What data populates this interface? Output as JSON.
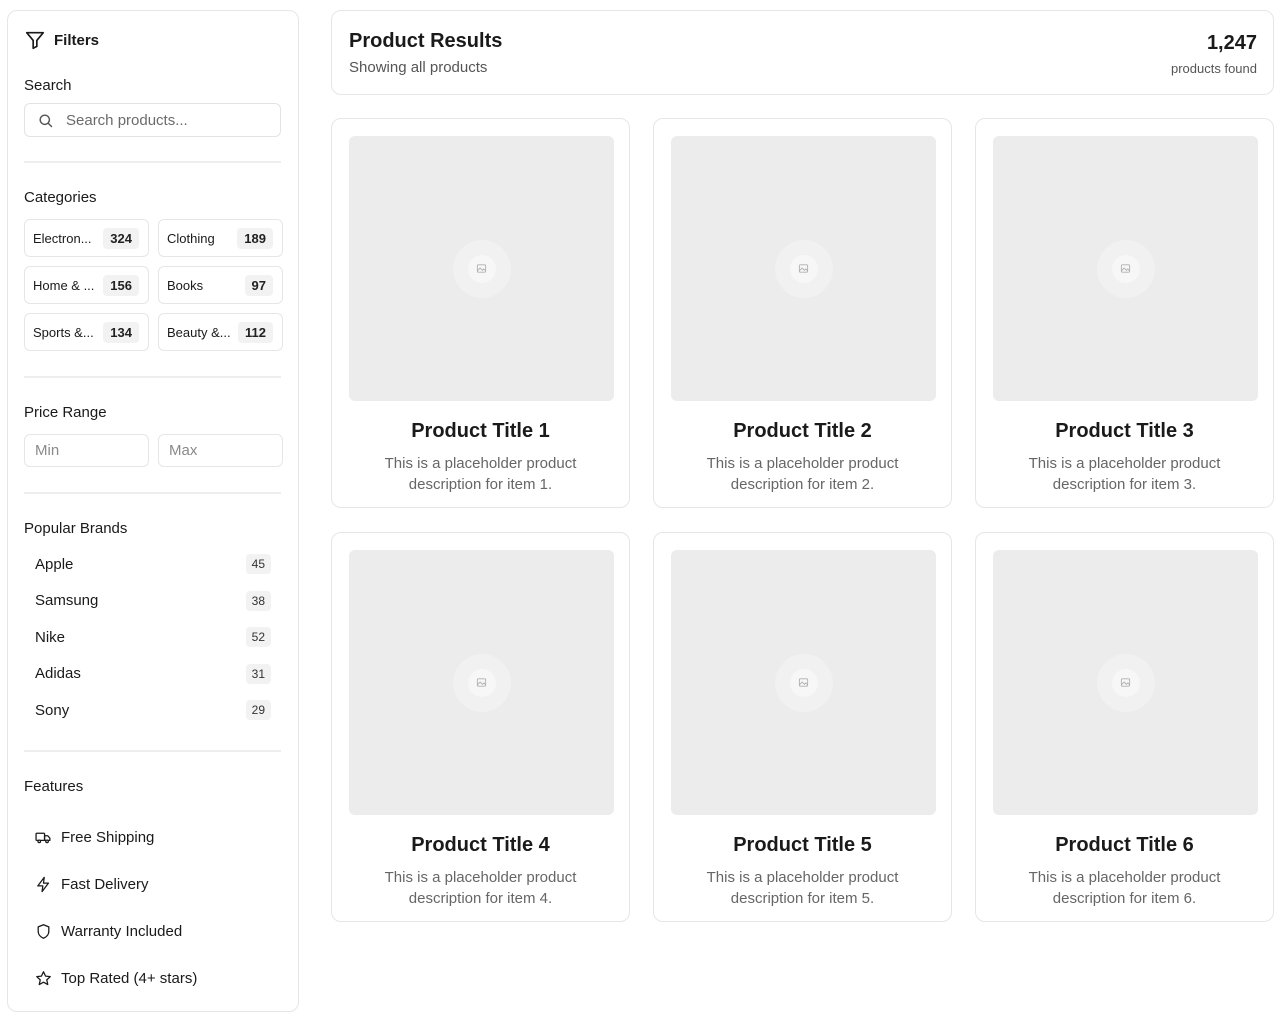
{
  "sidebar": {
    "title": "Filters",
    "search": {
      "label": "Search",
      "placeholder": "Search products..."
    },
    "categories": {
      "label": "Categories",
      "items": [
        {
          "name": "Electron...",
          "count": "324"
        },
        {
          "name": "Clothing",
          "count": "189"
        },
        {
          "name": "Home & ...",
          "count": "156"
        },
        {
          "name": "Books",
          "count": "97"
        },
        {
          "name": "Sports &...",
          "count": "134"
        },
        {
          "name": "Beauty &...",
          "count": "112"
        }
      ]
    },
    "price": {
      "label": "Price Range",
      "min_placeholder": "Min",
      "max_placeholder": "Max"
    },
    "brands": {
      "label": "Popular Brands",
      "items": [
        {
          "name": "Apple",
          "count": "45"
        },
        {
          "name": "Samsung",
          "count": "38"
        },
        {
          "name": "Nike",
          "count": "52"
        },
        {
          "name": "Adidas",
          "count": "31"
        },
        {
          "name": "Sony",
          "count": "29"
        }
      ]
    },
    "features": {
      "label": "Features",
      "items": [
        {
          "label": "Free Shipping",
          "icon": "truck-icon"
        },
        {
          "label": "Fast Delivery",
          "icon": "lightning-icon"
        },
        {
          "label": "Warranty Included",
          "icon": "shield-icon"
        },
        {
          "label": "Top Rated (4+ stars)",
          "icon": "star-icon"
        }
      ]
    }
  },
  "header": {
    "title": "Product Results",
    "subtitle": "Showing all products",
    "count": "1,247",
    "count_label": "products found"
  },
  "products": [
    {
      "title": "Product Title 1",
      "description": "This is a placeholder product description for item 1."
    },
    {
      "title": "Product Title 2",
      "description": "This is a placeholder product description for item 2."
    },
    {
      "title": "Product Title 3",
      "description": "This is a placeholder product description for item 3."
    },
    {
      "title": "Product Title 4",
      "description": "This is a placeholder product description for item 4."
    },
    {
      "title": "Product Title 5",
      "description": "This is a placeholder product description for item 5."
    },
    {
      "title": "Product Title 6",
      "description": "This is a placeholder product description for item 6."
    }
  ],
  "colors": {
    "border": "#e6e6e6",
    "placeholder_bg": "#ececec",
    "text": "#1a1a1a",
    "muted": "#666666"
  }
}
